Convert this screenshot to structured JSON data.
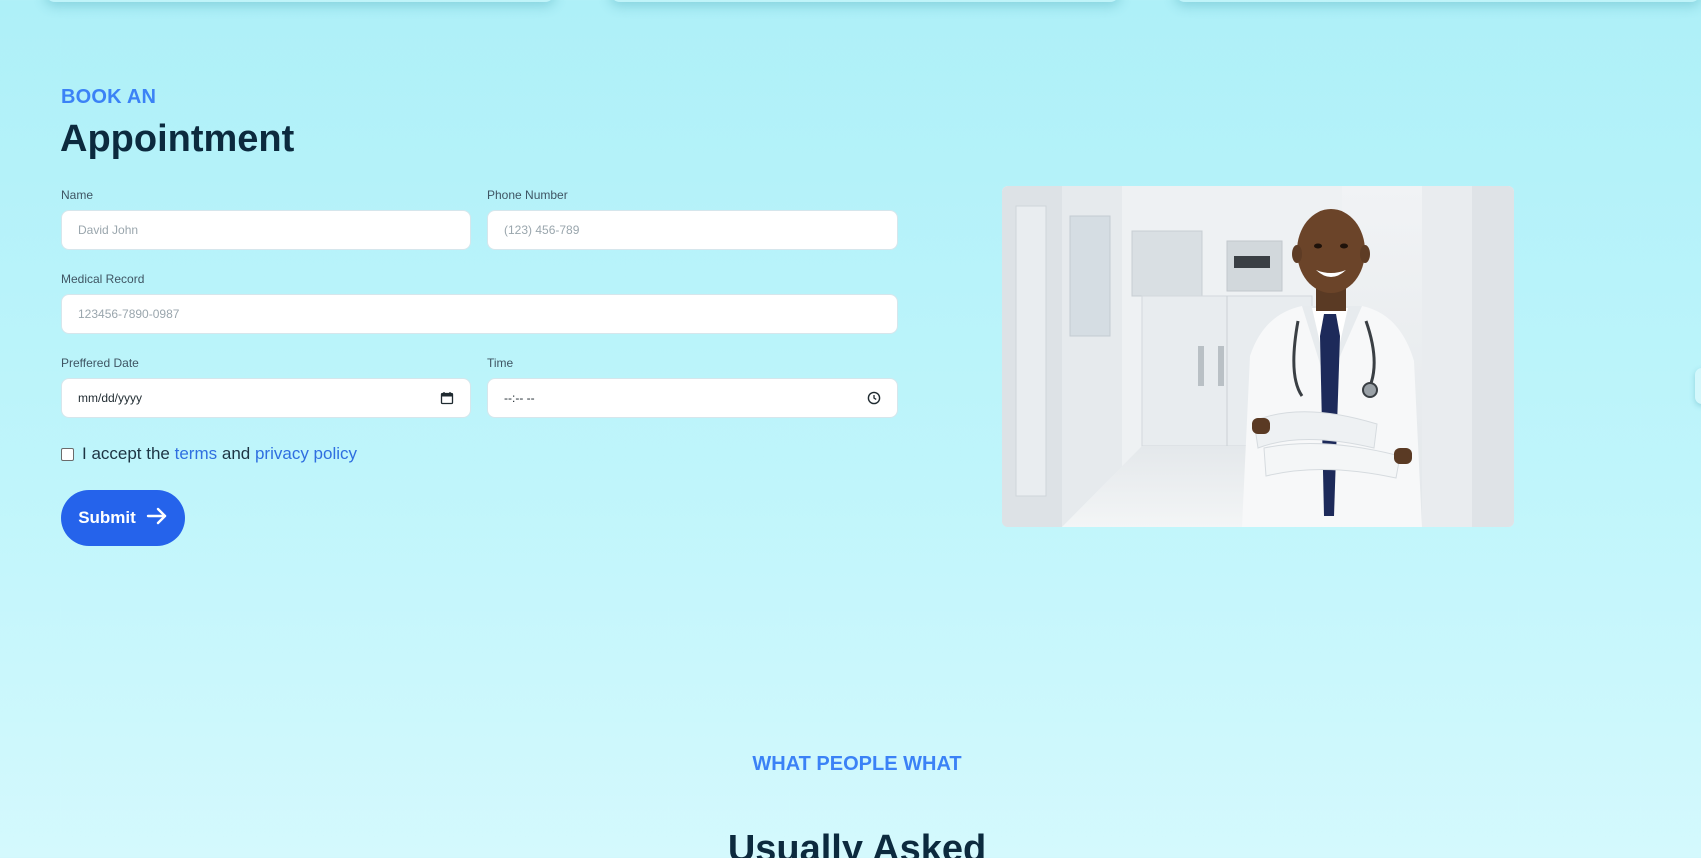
{
  "appointment": {
    "eyebrow": "BOOK AN",
    "title": "Appointment",
    "fields": {
      "name": {
        "label": "Name",
        "placeholder": "David John"
      },
      "phone": {
        "label": "Phone Number",
        "placeholder": "(123) 456-789"
      },
      "medical_record": {
        "label": "Medical Record",
        "placeholder": "123456-7890-0987"
      },
      "date": {
        "label": "Preffered Date",
        "value": "mm/dd/yyyy",
        "icon": "calendar-icon"
      },
      "time": {
        "label": "Time",
        "value": "--:-- --",
        "icon": "clock-icon"
      }
    },
    "consent": {
      "prefix": "I accept the",
      "terms_link": "terms",
      "middle": "and",
      "privacy_link": "privacy policy"
    },
    "submit_label": "Submit",
    "submit_icon": "arrow-right-icon",
    "image": "doctor-portrait"
  },
  "faq": {
    "eyebrow": "WHAT PEOPLE WHAT",
    "title": "Usually Asked"
  },
  "colors": {
    "accent": "#3b82f6",
    "button": "#2563eb",
    "heading": "#0c2a3e",
    "background": "#aef0f8"
  }
}
